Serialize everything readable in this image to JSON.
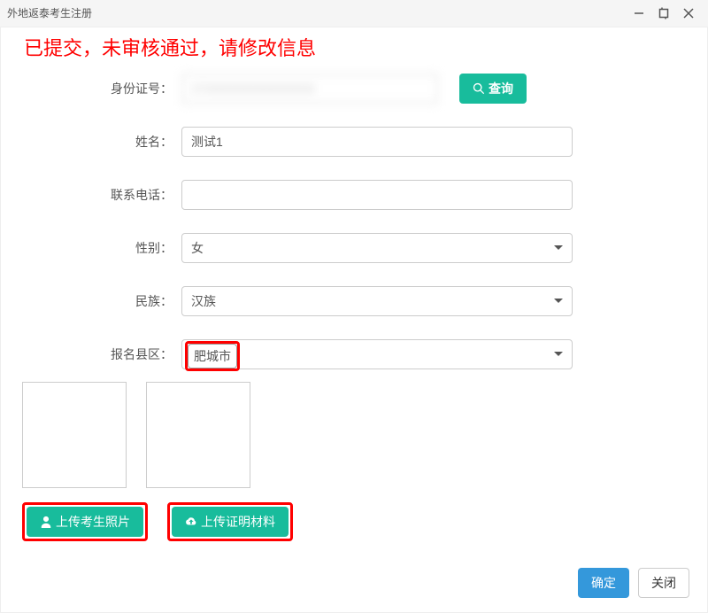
{
  "window": {
    "title": "外地返泰考生注册"
  },
  "status": {
    "message": "已提交，未审核通过，请修改信息"
  },
  "form": {
    "id_label": "身份证号：",
    "id_value": "370000000000000000",
    "query_label": "查询",
    "name_label": "姓名：",
    "name_value": "测试1",
    "phone_label": "联系电话：",
    "phone_value": "",
    "gender_label": "性别：",
    "gender_value": "女",
    "ethnic_label": "民族：",
    "ethnic_value": "汉族",
    "county_label": "报名县区：",
    "county_value": "肥城市"
  },
  "upload": {
    "photo_label": "上传考生照片",
    "material_label": "上传证明材料"
  },
  "footer": {
    "ok": "确定",
    "close": "关闭"
  }
}
